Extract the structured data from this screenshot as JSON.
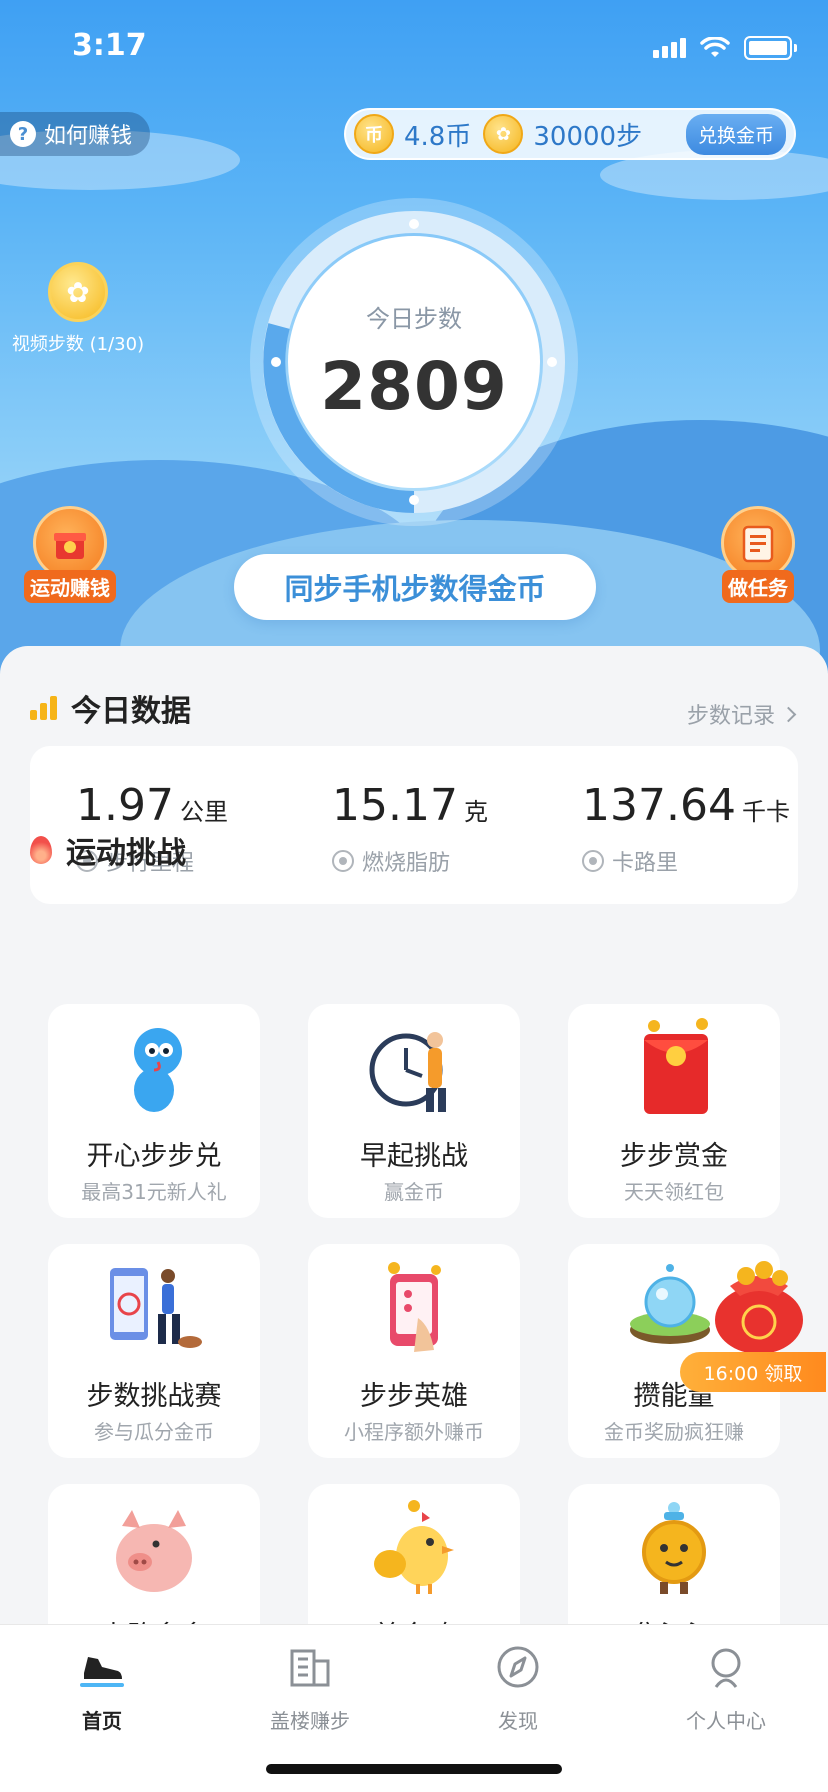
{
  "status_bar": {
    "time": "3:17"
  },
  "header": {
    "how_to_earn": "如何赚钱",
    "coin_symbol": "币",
    "coins": "4.8币",
    "steps_balance": "30000步",
    "exchange_label": "兑换金币"
  },
  "video_steps": {
    "label": "视频步数 (1/30)",
    "icon": "foot-icon"
  },
  "ring": {
    "label": "今日步数",
    "steps": "2809"
  },
  "side_buttons": {
    "left": "运动赚钱",
    "right": "做任务"
  },
  "sync_button": "同步手机步数得金币",
  "today": {
    "title": "今日数据",
    "record_link": "步数记录",
    "stats": [
      {
        "value": "1.97",
        "unit": "公里",
        "label": "步行里程"
      },
      {
        "value": "15.17",
        "unit": "克",
        "label": "燃烧脂肪"
      },
      {
        "value": "137.64",
        "unit": "千卡",
        "label": "卡路里"
      }
    ]
  },
  "challenges": {
    "title": "运动挑战",
    "cards": [
      {
        "name": "开心步步兑",
        "sub": "最高31元新人礼"
      },
      {
        "name": "早起挑战",
        "sub": "赢金币"
      },
      {
        "name": "步步赏金",
        "sub": "天天领红包"
      },
      {
        "name": "步数挑战赛",
        "sub": "参与瓜分金币"
      },
      {
        "name": "步步英雄",
        "sub": "小程序额外赚币"
      },
      {
        "name": "攒能量",
        "sub": "金币奖励疯狂赚"
      },
      {
        "name": "走路多多",
        "sub": ""
      },
      {
        "name": "美金鸡",
        "sub": ""
      },
      {
        "name": "集汪汪",
        "sub": ""
      }
    ],
    "time_badge": "16:00 领取"
  },
  "tabbar": [
    {
      "label": "首页",
      "icon": "shoe-icon",
      "active": true
    },
    {
      "label": "盖楼赚步",
      "icon": "building-icon",
      "active": false
    },
    {
      "label": "发现",
      "icon": "compass-icon",
      "active": false
    },
    {
      "label": "个人中心",
      "icon": "person-icon",
      "active": false
    }
  ],
  "colors": {
    "accent_blue": "#3b8fd8",
    "coin_gold": "#f5b51e",
    "orange": "#f47b1e",
    "bar_yellow": "#f6b417"
  }
}
